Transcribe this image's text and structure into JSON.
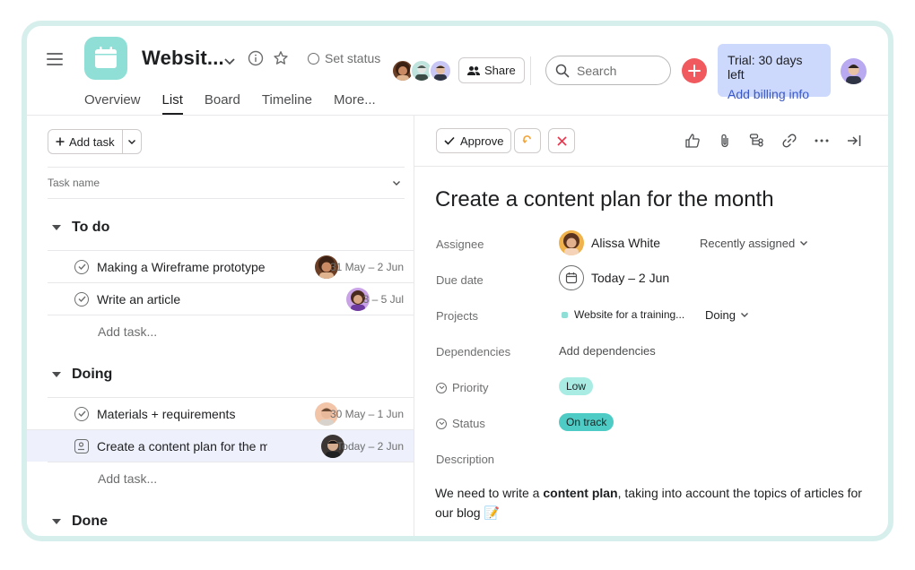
{
  "header": {
    "project_title": "Websit...",
    "set_status": "Set status",
    "share_label": "Share",
    "search_placeholder": "Search",
    "trial_line1": "Trial: 30 days left",
    "trial_line2": "Add billing info"
  },
  "tabs": [
    {
      "label": "Overview"
    },
    {
      "label": "List"
    },
    {
      "label": "Board"
    },
    {
      "label": "Timeline"
    },
    {
      "label": "More..."
    }
  ],
  "list": {
    "add_task_label": "Add task",
    "column_task_name": "Task name",
    "sections": [
      {
        "title": "To do",
        "tasks": [
          {
            "name": "Making a Wireframe prototype",
            "date": "31 May – 2 Jun"
          },
          {
            "name": "Write an article",
            "date": "3 – 5 Jul"
          }
        ],
        "add_task": "Add task..."
      },
      {
        "title": "Doing",
        "tasks": [
          {
            "name": "Materials + requirements",
            "date": "30 May – 1 Jun"
          },
          {
            "name": "Create a content plan for the month",
            "date": "Today – 2 Jun"
          }
        ],
        "add_task": "Add task..."
      },
      {
        "title": "Done",
        "tasks": []
      }
    ]
  },
  "detail": {
    "approve_label": "Approve",
    "title": "Create a content plan for the month",
    "fields": {
      "assignee_label": "Assignee",
      "assignee_name": "Alissa White",
      "recently_assigned": "Recently assigned",
      "due_label": "Due date",
      "due_value": "Today – 2 Jun",
      "projects_label": "Projects",
      "project_name": "Website for a training...",
      "project_section": "Doing",
      "dependencies_label": "Dependencies",
      "dependencies_value": "Add dependencies",
      "priority_label": "Priority",
      "priority_value": "Low",
      "status_label": "Status",
      "status_value": "On track",
      "description_label": "Description"
    },
    "description": {
      "before": "We need to write a ",
      "bold": "content plan",
      "after": ", taking into account the topics of articles for our blog",
      "emoji": "📝"
    }
  },
  "colors": {
    "project_icon": "#8fdfd7",
    "add_button": "#f0595d",
    "trial_bg": "#ccd9fd",
    "priority_low": "#a8ece3",
    "status_on_track": "#4ecbc4",
    "selected_row": "#eef0fb",
    "frame_border": "#d7efec"
  }
}
